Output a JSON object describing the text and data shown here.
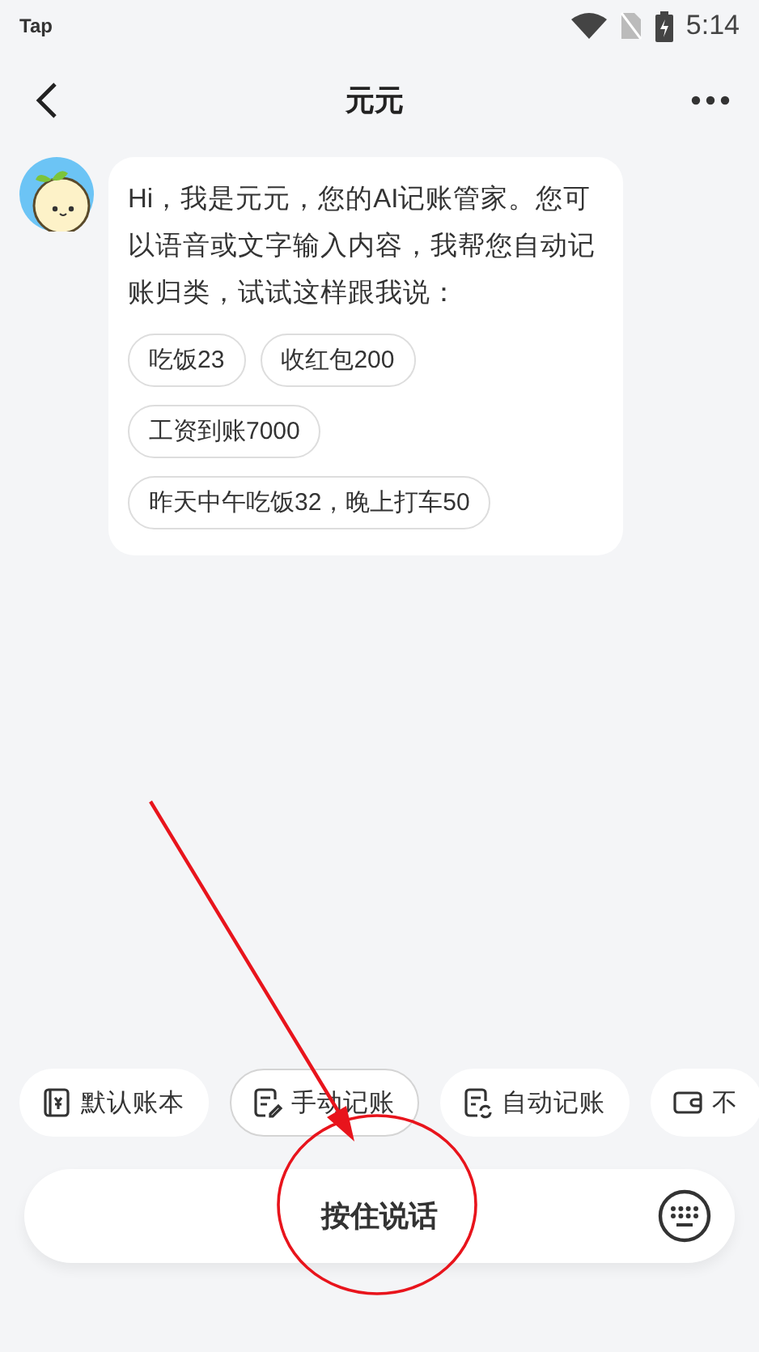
{
  "status_bar": {
    "app_label": "Tap",
    "time": "5:14"
  },
  "header": {
    "title": "元元"
  },
  "message": {
    "text": "Hi，我是元元，您的AI记账管家。您可以语音或文字输入内容，我帮您自动记账归类，试试这样跟我说：",
    "suggestions": [
      "吃饭23",
      "收红包200",
      "工资到账7000",
      "昨天中午吃饭32，晚上打车50"
    ]
  },
  "quick_actions": [
    {
      "label": "默认账本",
      "kind": "book",
      "selected": false
    },
    {
      "label": "手动记账",
      "kind": "manual",
      "selected": true
    },
    {
      "label": "自动记账",
      "kind": "auto",
      "selected": false
    },
    {
      "label": "不",
      "kind": "wallet",
      "selected": false
    }
  ],
  "input_bar": {
    "label": "按住说话"
  }
}
